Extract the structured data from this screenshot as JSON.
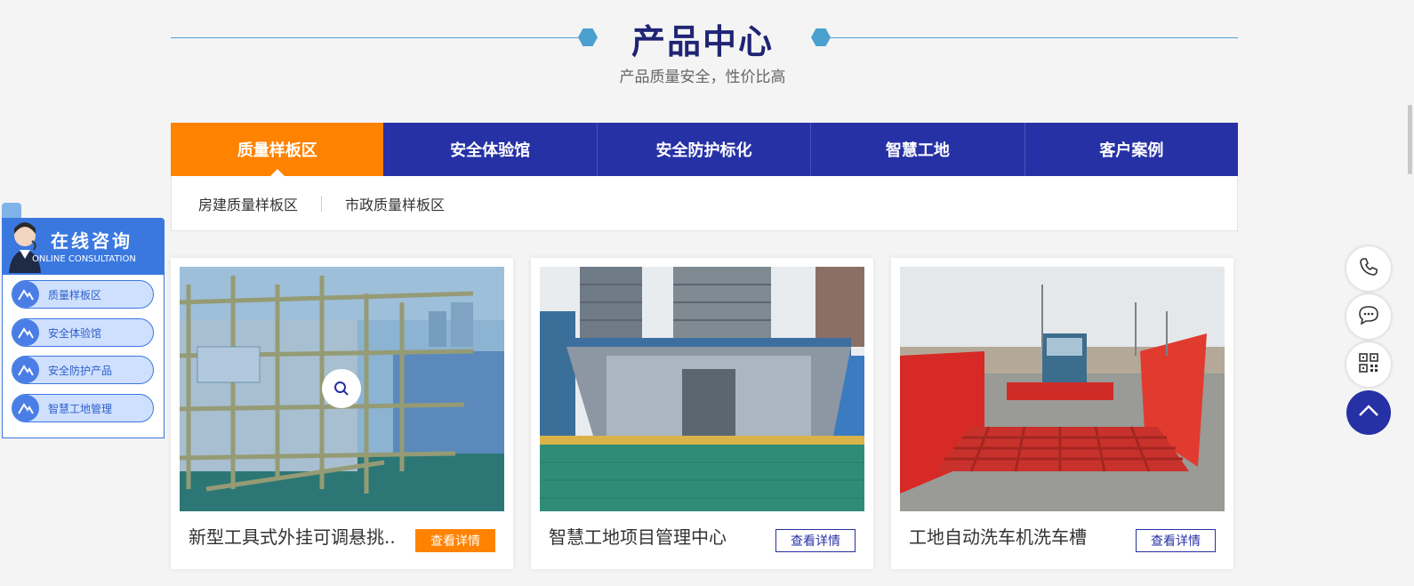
{
  "section": {
    "title": "产品中心",
    "subtitle": "产品质量安全，性价比高",
    "accent": "#4aa0cf",
    "title_color": "#1f2475"
  },
  "tabs": [
    {
      "label": "质量样板区",
      "active": true
    },
    {
      "label": "安全体验馆",
      "active": false
    },
    {
      "label": "安全防护标化",
      "active": false
    },
    {
      "label": "智慧工地",
      "active": false
    },
    {
      "label": "客户案例",
      "active": false
    }
  ],
  "subtabs": [
    "房建质量样板区",
    "市政质量样板区"
  ],
  "products": [
    {
      "title": "新型工具式外挂可调悬挑..",
      "button": "查看详情",
      "hovered": true
    },
    {
      "title": "智慧工地项目管理中心",
      "button": "查看详情",
      "hovered": false
    },
    {
      "title": "工地自动洗车机洗车槽",
      "button": "查看详情",
      "hovered": false
    }
  ],
  "consult": {
    "title": "在线咨询",
    "subtitle": "ONLINE CONSULTATION",
    "items": [
      "质量样板区",
      "安全体验馆",
      "安全防护产品",
      "智慧工地管理"
    ]
  },
  "float_tools": [
    "phone-icon",
    "chat-icon",
    "qrcode-icon",
    "back-to-top-icon"
  ],
  "colors": {
    "brand": "#2631a5",
    "highlight": "#ff8200",
    "consult": "#3a78e0"
  }
}
